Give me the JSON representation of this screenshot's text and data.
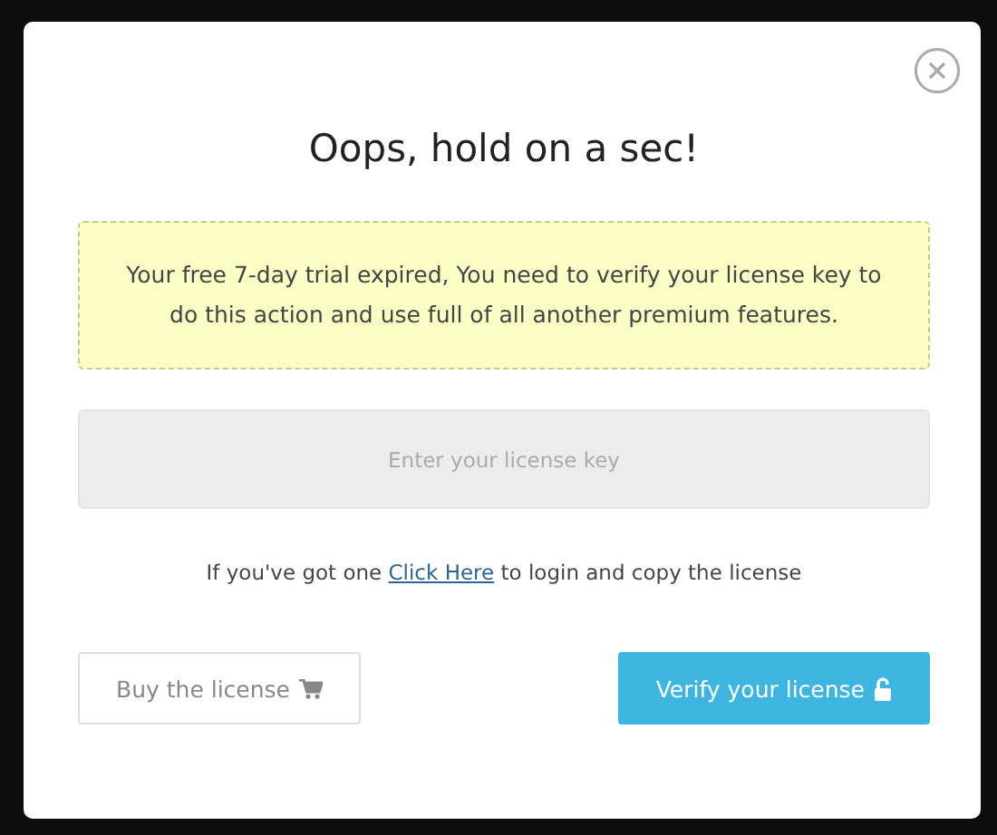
{
  "dialog": {
    "title": "Oops, hold on a sec!",
    "notice": "Your free 7-day trial expired, You need to verify your license key to do this action and use full of all another premium features.",
    "license_field": {
      "placeholder": "Enter your license key"
    },
    "help": {
      "before": "If you've got one ",
      "link": "Click Here",
      "after": " to login and copy the license"
    },
    "buttons": [
      {
        "label": "Buy the license",
        "kind": "secondary"
      },
      {
        "label": "Verify your license",
        "kind": "primary"
      }
    ]
  }
}
